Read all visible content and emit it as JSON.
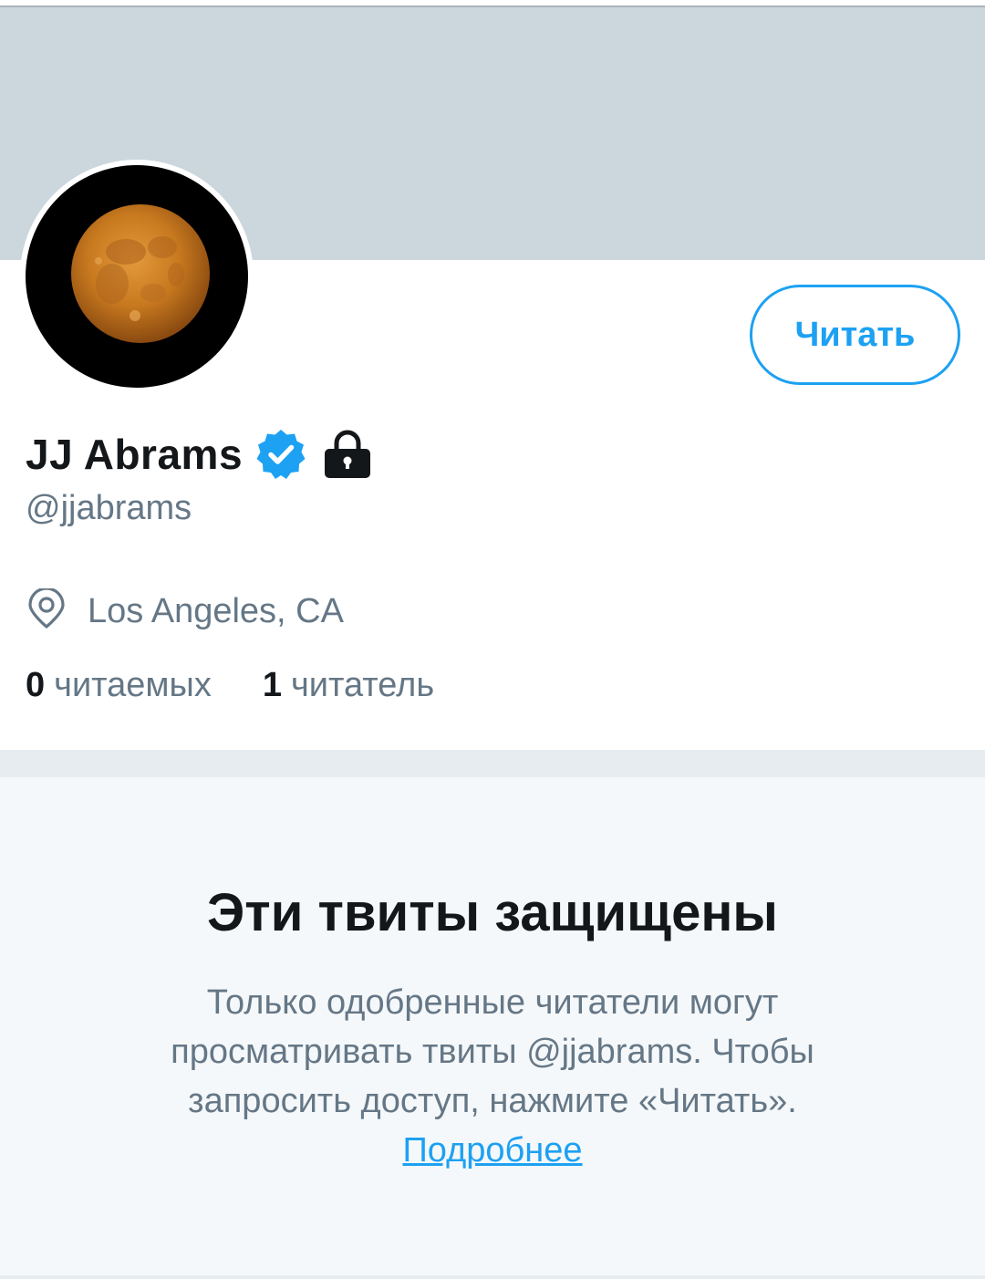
{
  "profile": {
    "display_name": "JJ Abrams",
    "handle": "@jjabrams",
    "verified_icon": "verified-badge-icon",
    "lock_icon": "lock-icon",
    "location": "Los Angeles, CA",
    "location_icon": "map-pin-icon",
    "avatar": "full-moon-avatar"
  },
  "follow_button": {
    "label": "Читать"
  },
  "stats": {
    "following_count": "0",
    "following_label": "читаемых",
    "followers_count": "1",
    "followers_label": "читатель"
  },
  "protected_notice": {
    "title": "Эти твиты защищены",
    "body": "Только одобренные читатели могут просматривать твиты @jjabrams. Чтобы запросить доступ, нажмите «Читать».",
    "link": "Подробнее"
  },
  "colors": {
    "accent": "#1da1f2",
    "banner": "#ccd6dd",
    "text_primary": "#14171a",
    "text_secondary": "#657786",
    "background_muted": "#f5f8fa"
  }
}
